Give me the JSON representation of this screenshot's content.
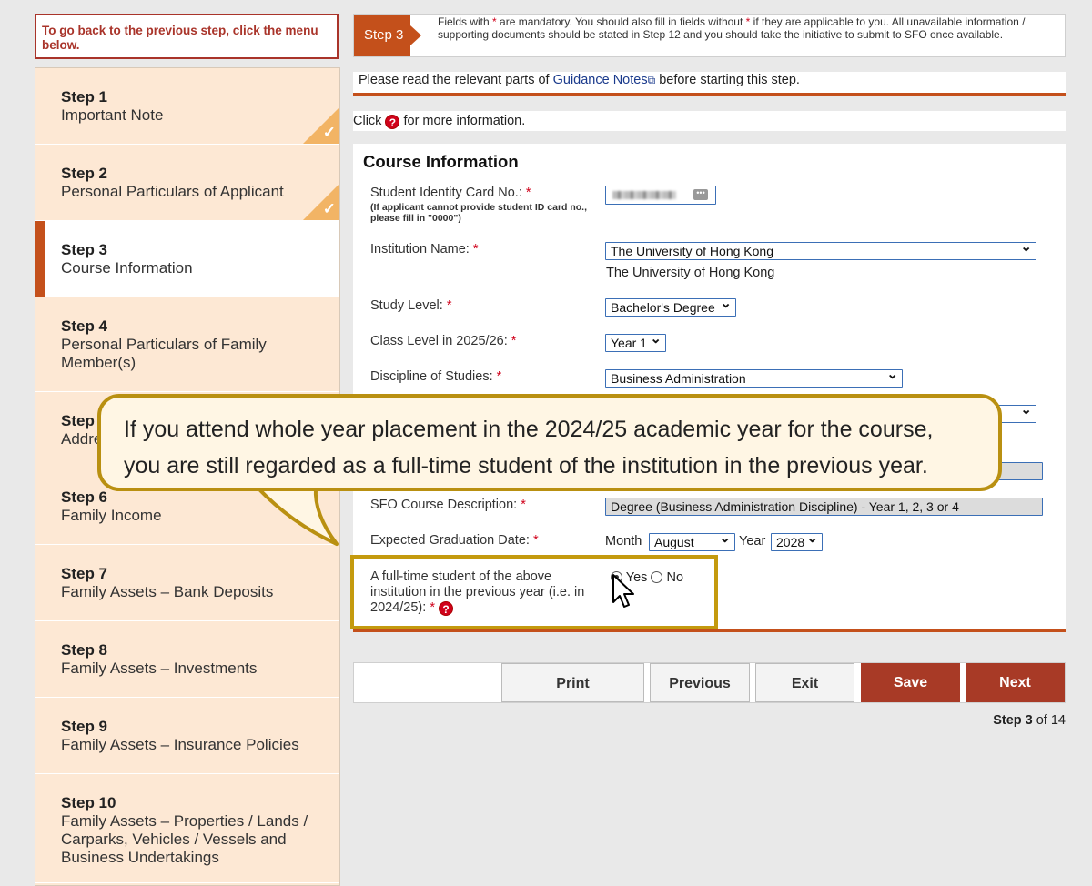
{
  "back_note": "To go back to the previous step, click the menu below.",
  "sidebar": {
    "items": [
      {
        "num": "Step 1",
        "desc": "Important Note",
        "done": true
      },
      {
        "num": "Step 2",
        "desc": "Personal Particulars of Applicant",
        "done": true
      },
      {
        "num": "Step 3",
        "desc": "Course Information",
        "active": true
      },
      {
        "num": "Step 4",
        "desc": "Personal Particulars of Family Member(s)"
      },
      {
        "num": "Step 5",
        "desc": "Address"
      },
      {
        "num": "Step 6",
        "desc": "Family Income"
      },
      {
        "num": "Step 7",
        "desc": "Family Assets – Bank Deposits"
      },
      {
        "num": "Step 8",
        "desc": "Family Assets – Investments"
      },
      {
        "num": "Step 9",
        "desc": "Family Assets – Insurance Policies"
      },
      {
        "num": "Step 10",
        "desc": "Family Assets – Properties / Lands / Carparks, Vehicles / Vessels and Business Undertakings"
      }
    ]
  },
  "header": {
    "step_tag": "Step 3",
    "info_1": "Fields with ",
    "info_star": "*",
    "info_2": " are mandatory. You should also fill in fields without ",
    "info_3": " if they are applicable to you. All unavailable information / supporting documents should be stated in Step 12 and you should take the initiative to submit to SFO once available."
  },
  "guide": {
    "before": "Please read the relevant parts of ",
    "link": "Guidance Notes",
    "after": " before starting this step."
  },
  "click_info": {
    "before": "Click ",
    "after": " for more information."
  },
  "help_icon": "?",
  "form": {
    "title": "Course Information",
    "sid_label": "Student Identity Card No.: ",
    "sid_note": "(If applicant cannot provide student ID card no., please fill in \"0000\")",
    "inst_label": "Institution Name: ",
    "inst_value": "The University of Hong Kong",
    "inst_text": "The University of Hong Kong",
    "study_label": "Study Level: ",
    "study_value": "Bachelor's Degree",
    "class_label": "Class Level in 2025/26: ",
    "class_value": "Year 1",
    "disc_label": "Discipline of Studies: ",
    "disc_value": "Business Administration",
    "sfo_label": "SFO Course Description: ",
    "sfo_value": "Degree (Business Administration Discipline) - Year 1, 2, 3 or 4",
    "grad_label": "Expected Graduation Date: ",
    "month_label": "Month",
    "month_value": "August",
    "year_label": "Year",
    "year_value": "2028",
    "ft_label": "A full-time student of the above institution in the previous year (i.e. in 2024/25): ",
    "yes": "Yes",
    "no": "No",
    "ft_selected": "Yes",
    "star": "*"
  },
  "bubble": {
    "line1": "If you attend whole year placement in the 2024/25 academic year for the course,",
    "line2": "you are still regarded as a full-time student of the institution in the previous year."
  },
  "buttons": {
    "print": "Print",
    "previous": "Previous",
    "exit": "Exit",
    "save": "Save",
    "next": "Next"
  },
  "pager": {
    "current": "Step 3",
    "of": " of 14"
  },
  "colors": {
    "accent": "#c4501b",
    "button_dark": "#a83a26",
    "highlight": "#c49a0e",
    "sidebar_bg": "#fde8d4"
  }
}
